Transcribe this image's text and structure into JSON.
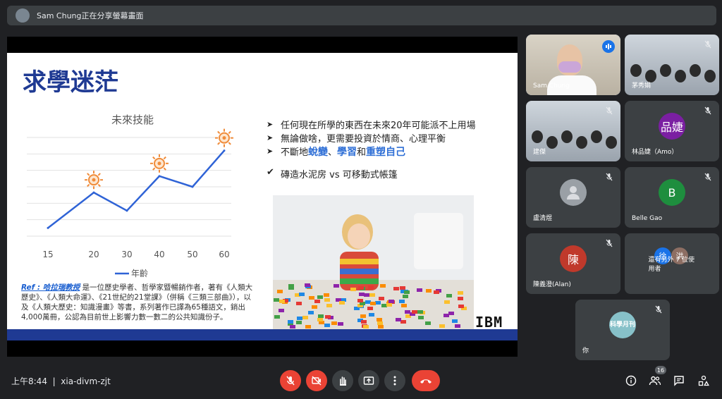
{
  "banner": {
    "text": "Sam Chung正在分享螢幕畫面"
  },
  "slide": {
    "title": "求學迷茫",
    "chart_title": "未來技能",
    "legend": "年齡",
    "bullets": [
      {
        "pre": "任何現在所學的東西在未來20年可能派不上用場",
        "parts": []
      },
      {
        "pre": "無論做啥，更需要投資於情商、心理平衡",
        "parts": []
      },
      {
        "pre": "不斷地",
        "h1": "蛻變",
        "s1": "、",
        "h2": "學習",
        "s2": "和",
        "h3": "重塑自己"
      }
    ],
    "check": "磚造水泥房 vs 可移動式帳篷",
    "ref_label": "Ref : 哈拉瑞教授",
    "ref_text": " 是一位歷史學者、哲學家暨暢銷作者，著有《人類大歷史》、《人類大命運》、《21世紀的21堂課》（併稱《三類三部曲》），以及《人類大歷史：知識漫畫》等書，系列著作已譯為65種語文，銷出4,000萬冊，公認為目前世上影響力數一數二的公共知識份子。",
    "logo": "IBM"
  },
  "chart_data": {
    "type": "line",
    "title": "未來技能",
    "categories": [
      "15",
      "20",
      "30",
      "40",
      "50",
      "60"
    ],
    "series": [
      {
        "name": "年齡",
        "values": [
          1,
          5.3,
          3.1,
          7.3,
          6,
          10.4
        ]
      }
    ],
    "ylim": [
      0,
      12
    ],
    "grid": true,
    "legend": "bottom",
    "color": "#2f63d6"
  },
  "participants": [
    {
      "name": "Sam Chung",
      "kind": "video",
      "speaking": true
    },
    {
      "name": "茅秀娟",
      "kind": "video"
    },
    {
      "name": "建傑",
      "kind": "video"
    },
    {
      "name": "林品婕（Amo）",
      "kind": "letter",
      "letter": "品婕",
      "color": "#7b1fa2"
    },
    {
      "name": "盧清煜",
      "kind": "avatar"
    },
    {
      "name": "Belle Gao",
      "kind": "letter",
      "letter": "B",
      "color": "#1e8e3e"
    },
    {
      "name": "陳義澄(Alan)",
      "kind": "letter",
      "letter": "陳",
      "color": "#c0392b"
    },
    {
      "name": "還有另外 7 位使用者",
      "kind": "group",
      "a": "徐",
      "b": "洪"
    },
    {
      "name": "你",
      "kind": "logo",
      "letter": "科學月刊"
    }
  ],
  "bottom": {
    "time": "上午8:44",
    "meeting_code": "xia-divm-zjt",
    "people_count": "16"
  },
  "icons": [
    "mic-off-icon",
    "camera-off-icon",
    "hand-icon",
    "present-icon",
    "more-icon",
    "end-call-icon",
    "info-icon",
    "people-icon",
    "chat-icon",
    "activities-icon"
  ]
}
